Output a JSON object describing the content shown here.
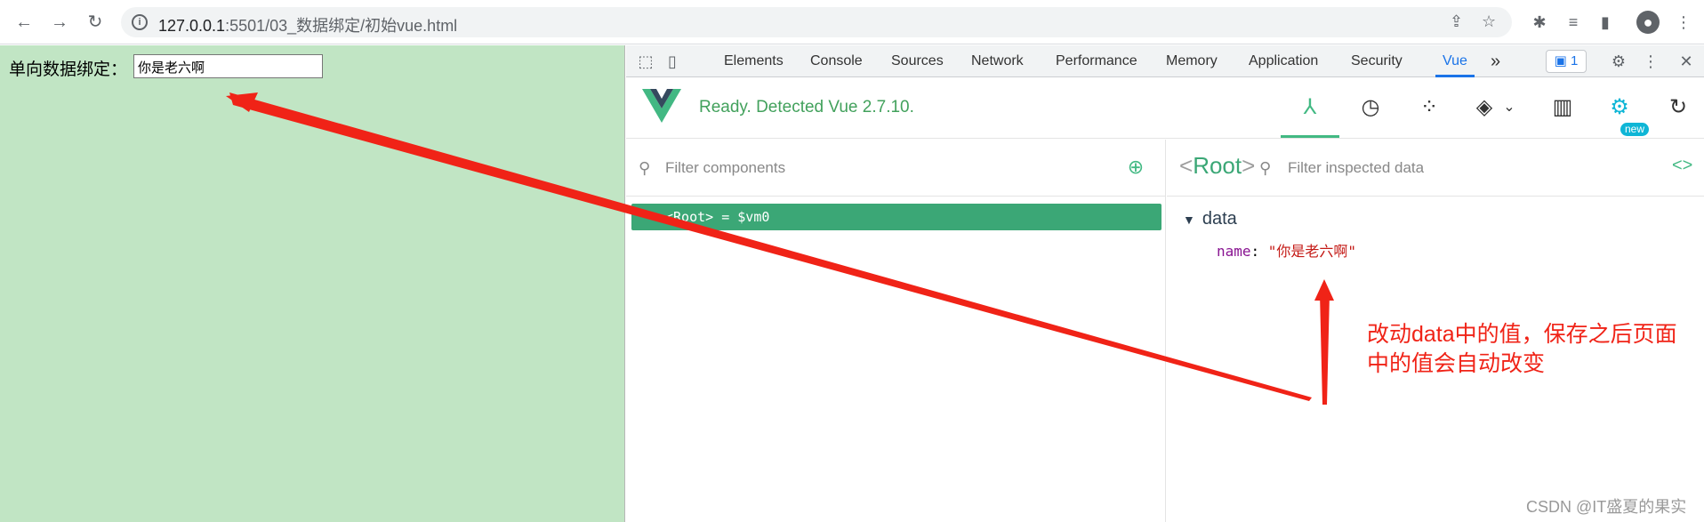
{
  "browser": {
    "url_host": "127.0.0.1",
    "url_rest": ":5501/03_数据绑定/初始vue.html"
  },
  "page": {
    "label": "单向数据绑定：",
    "input_value": "你是老六啊"
  },
  "devtools": {
    "tabs": [
      "Elements",
      "Console",
      "Sources",
      "Network",
      "Performance",
      "Memory",
      "Application",
      "Security",
      "Vue"
    ],
    "active_tab": "Vue",
    "more": "»",
    "issues_count": "1",
    "vue_status": "Ready. Detected Vue 2.7.10.",
    "new_badge": "new",
    "filter_components_placeholder": "Filter components",
    "root_row": "<Root> = $vm0",
    "inspector_root_open": "<",
    "inspector_root_name": "Root",
    "inspector_root_close": ">",
    "filter_data_placeholder": "Filter inspected data",
    "code_icon": "<>",
    "data_section": "data",
    "data_key": "name",
    "data_value": "\"你是老六啊\""
  },
  "annotation": {
    "line1": "改动data中的值，保存之后页面",
    "line2": "中的值会自动改变",
    "color": "#f02317"
  },
  "watermark": "CSDN @IT盛夏的果实",
  "colors": {
    "vue_green": "#42b983",
    "page_bg": "#c1e5c4",
    "chrome_blue": "#1a73e8"
  }
}
